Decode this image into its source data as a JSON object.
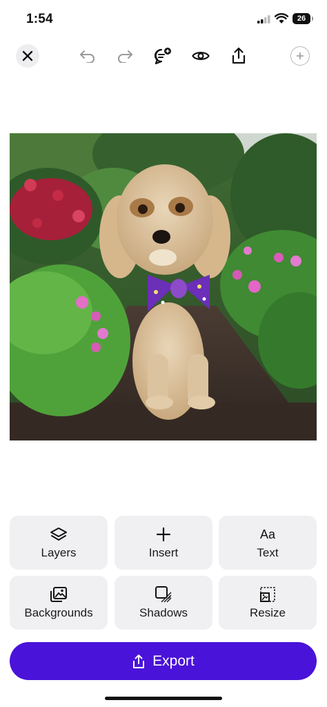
{
  "status": {
    "time": "1:54",
    "battery": "26"
  },
  "toolbar": {
    "close": "close-icon",
    "undo": "undo-icon",
    "redo": "redo-icon",
    "comment": "comment-add-icon",
    "preview": "eye-icon",
    "share": "share-icon",
    "add": "plus-icon"
  },
  "tools": [
    {
      "label": "Layers",
      "icon": "layers-icon"
    },
    {
      "label": "Insert",
      "icon": "plus-icon"
    },
    {
      "label": "Text",
      "icon": "text-icon",
      "glyph": "Aa"
    },
    {
      "label": "Backgrounds",
      "icon": "backgrounds-icon"
    },
    {
      "label": "Shadows",
      "icon": "shadows-icon"
    },
    {
      "label": "Resize",
      "icon": "resize-icon"
    }
  ],
  "export": {
    "label": "Export"
  },
  "colors": {
    "accent": "#4a13d9",
    "tile_bg": "#f0f0f3"
  }
}
